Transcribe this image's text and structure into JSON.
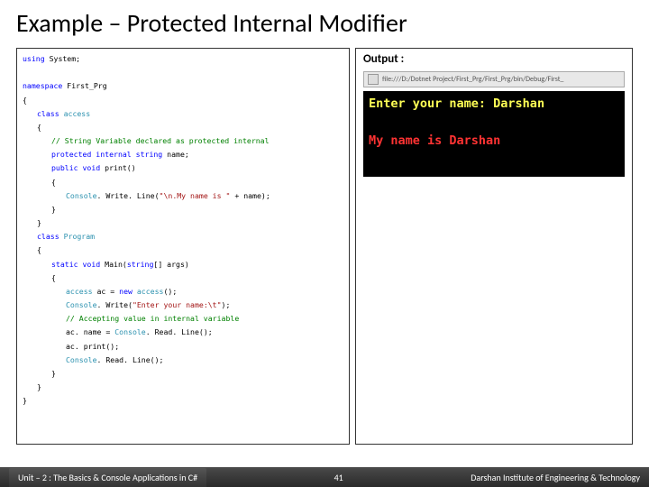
{
  "title": "Example – Protected Internal Modifier",
  "code": {
    "l1a": "using",
    "l1b": " System;",
    "l3a": "namespace",
    "l3b": " First_Prg",
    "l5a": "class",
    "l5b": " access",
    "l7": "// String Variable declared as protected internal",
    "l8a": "protected internal string",
    "l8b": " name;",
    "l9a": "public void",
    "l9b": " print()",
    "l11a": "Console",
    "l11b": ". Write. Line(",
    "l11c": "\"\\n.My name is \"",
    "l11d": " + name);",
    "l14a": "class",
    "l14b": " Program",
    "l16a": "static void",
    "l16b": " Main(",
    "l16c": "string",
    "l16d": "[] args)",
    "l18a": "access",
    "l18b": " ac = ",
    "l18c": "new",
    "l18d": " access",
    "l18e": "();",
    "l19a": "Console",
    "l19b": ". Write(",
    "l19c": "\"Enter your name:\\t\"",
    "l19d": ");",
    "l20": "// Accepting value in internal variable",
    "l21a": "ac. name = ",
    "l21b": "Console",
    "l21c": ". Read. Line();",
    "l22": "ac. print();",
    "l23a": "Console",
    "l23b": ". Read. Line();",
    "brace_open": "{",
    "brace_close": "}"
  },
  "output": {
    "label": "Output :",
    "url": "file:///D:/Dotnet Project/First_Prg/First_Prg/bin/Debug/First_",
    "line1a": "Enter your name: ",
    "line1b": "Darshan",
    "line2a": "My name is ",
    "line2b": "Darshan"
  },
  "footer": {
    "left": "Unit – 2 : The Basics & Console Applications in C#",
    "page": "41",
    "right": "Darshan Institute of Engineering & Technology"
  }
}
